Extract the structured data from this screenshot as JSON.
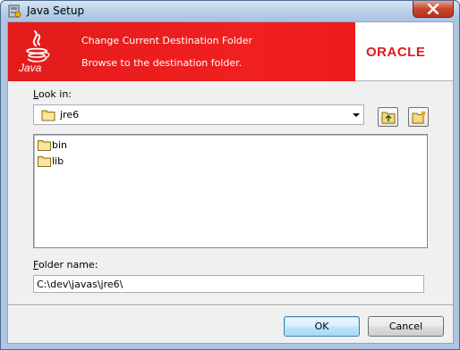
{
  "window": {
    "title": "Java Setup"
  },
  "banner": {
    "heading": "Change Current Destination Folder",
    "subheading": "Browse to the destination folder.",
    "java_text": "Java",
    "oracle_logo": "ORACLE"
  },
  "look_in": {
    "label_prefix": "L",
    "label_rest": "ook in:",
    "selected": "jre6"
  },
  "files": [
    {
      "name": "bin",
      "icon": "folder-icon"
    },
    {
      "name": "lib",
      "icon": "folder-icon"
    }
  ],
  "folder_name": {
    "label_prefix": "F",
    "label_rest": "older name:",
    "value": "C:\\dev\\javas\\jre6\\"
  },
  "buttons": {
    "ok": "OK",
    "cancel": "Cancel"
  },
  "colors": {
    "banner_red": "#e31b1b",
    "oracle_red": "#e0191e"
  }
}
